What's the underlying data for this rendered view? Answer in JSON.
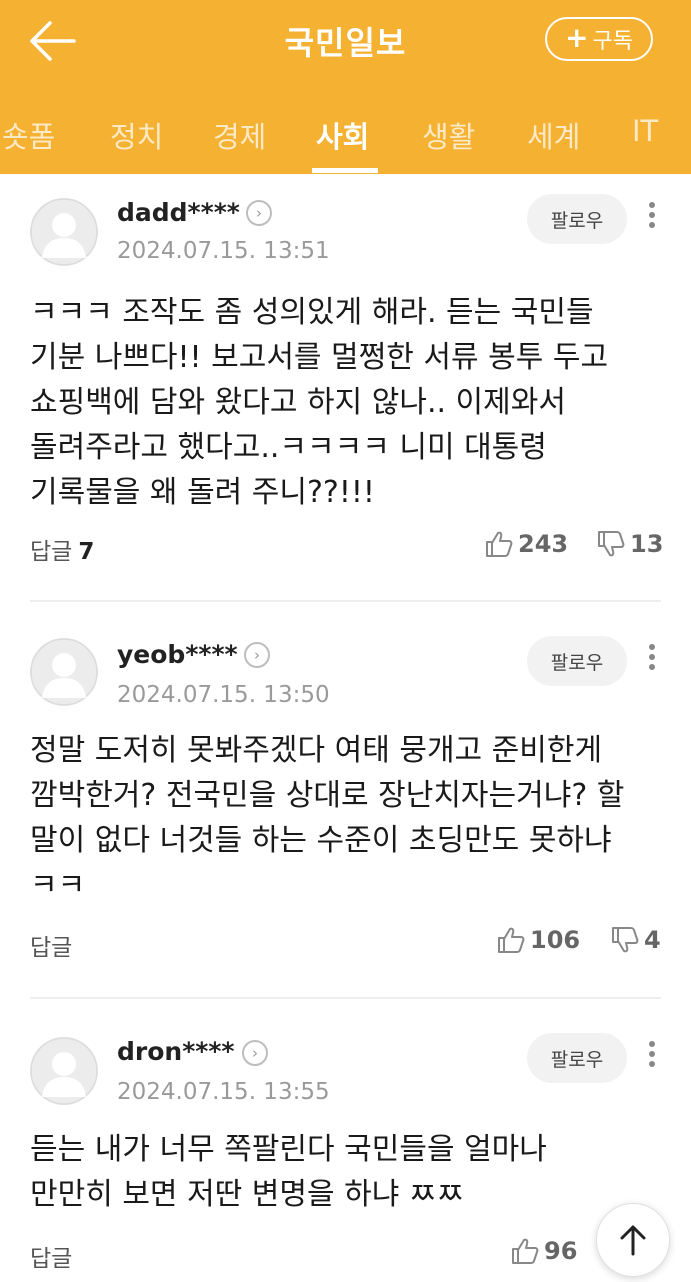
{
  "header": {
    "title": "국민일보",
    "subscribe_label": "구독",
    "back_icon": "arrow-left-icon",
    "colors": {
      "bar": "#f4b132",
      "text": "#ffffff"
    }
  },
  "tabs": [
    {
      "label": "숏폼",
      "active": false
    },
    {
      "label": "정치",
      "active": false
    },
    {
      "label": "경제",
      "active": false
    },
    {
      "label": "사회",
      "active": true
    },
    {
      "label": "생활",
      "active": false
    },
    {
      "label": "세계",
      "active": false
    },
    {
      "label": "IT",
      "active": false
    }
  ],
  "comments": [
    {
      "username": "dadd****",
      "timestamp": "2024.07.15. 13:51",
      "follow_label": "팔로우",
      "text": "ㅋㅋㅋ 조작도 좀 성의있게 해라. 듣는 국민들 기분 나쁘다!! 보고서를 멀쩡한 서류 봉투 두고 쇼핑백에 담와 왔다고 하지 않나.. 이제와서 돌려주라고 했다고..ㅋㅋㅋㅋ 니미 대통령 기록물을 왜 돌려 주니??!!!",
      "reply_label": "답글",
      "reply_count": "7",
      "likes": "243",
      "dislikes": "13"
    },
    {
      "username": "yeob****",
      "timestamp": "2024.07.15. 13:50",
      "follow_label": "팔로우",
      "text": "정말 도저히 못봐주겠다 여태 뭉개고 준비한게 깜박한거? 전국민을 상대로 장난치자는거냐? 할 말이 없다 너것들 하는 수준이 초딩만도 못하냐 ㅋㅋ",
      "reply_label": "답글",
      "reply_count": "",
      "likes": "106",
      "dislikes": "4"
    },
    {
      "username": "dron****",
      "timestamp": "2024.07.15. 13:55",
      "follow_label": "팔로우",
      "text": "듣는 내가 너무 쪽팔린다 국민들을 얼마나 만만히 보면 저딴 변명을 하냐 ㅉㅉ",
      "reply_label": "답글",
      "reply_count": "",
      "likes": "96",
      "dislikes": ""
    }
  ],
  "icons": {
    "like": "thumbs-up-icon",
    "dislike": "thumbs-down-icon",
    "more": "vertical-dots-icon",
    "scroll_top": "arrow-up-icon"
  }
}
